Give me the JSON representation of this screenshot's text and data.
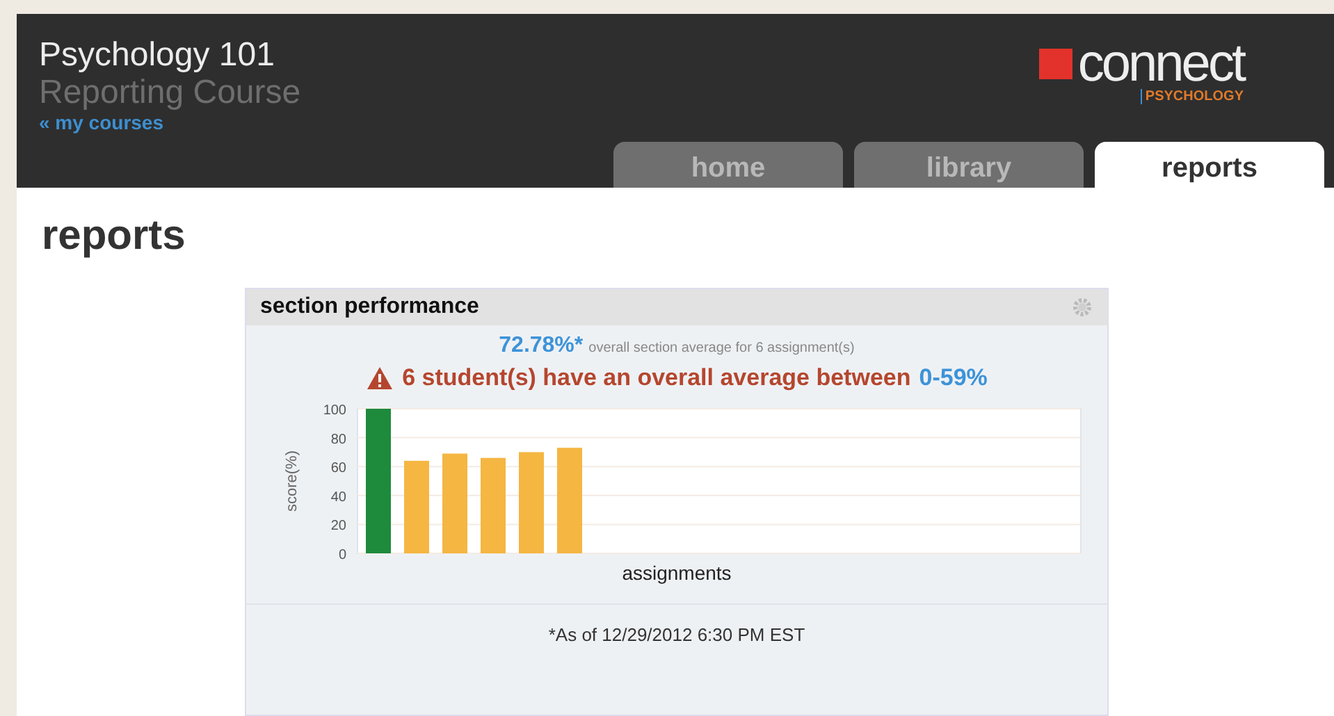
{
  "header": {
    "course_title": "Psychology 101",
    "course_subtitle": "Reporting Course",
    "back_link": "« my courses",
    "logo": {
      "wordmark": "connect",
      "subject": "PSYCHOLOGY"
    }
  },
  "tabs": [
    {
      "label": "home",
      "selected": false
    },
    {
      "label": "library",
      "selected": false
    },
    {
      "label": "reports",
      "selected": true
    }
  ],
  "page_title": "reports",
  "panel": {
    "title": "section performance",
    "average": {
      "value": "72.78%*",
      "label": "overall section average for 6 assignment(s)"
    },
    "alert": {
      "text": "6 student(s) have an overall average between",
      "range": "0-59%"
    },
    "chart_data": {
      "type": "bar",
      "xlabel": "assignments",
      "ylabel": "score(%)",
      "ylim": [
        0,
        100
      ],
      "yticks": [
        0,
        20,
        40,
        60,
        80,
        100
      ],
      "grid": true,
      "series": [
        {
          "colors": [
            "#1e8a3c",
            "#f5b642",
            "#f5b642",
            "#f5b642",
            "#f5b642",
            "#f5b642"
          ],
          "values": [
            100,
            64,
            69,
            66,
            70,
            73
          ]
        }
      ]
    },
    "footnote": "*As of 12/29/2012 6:30 PM EST"
  }
}
